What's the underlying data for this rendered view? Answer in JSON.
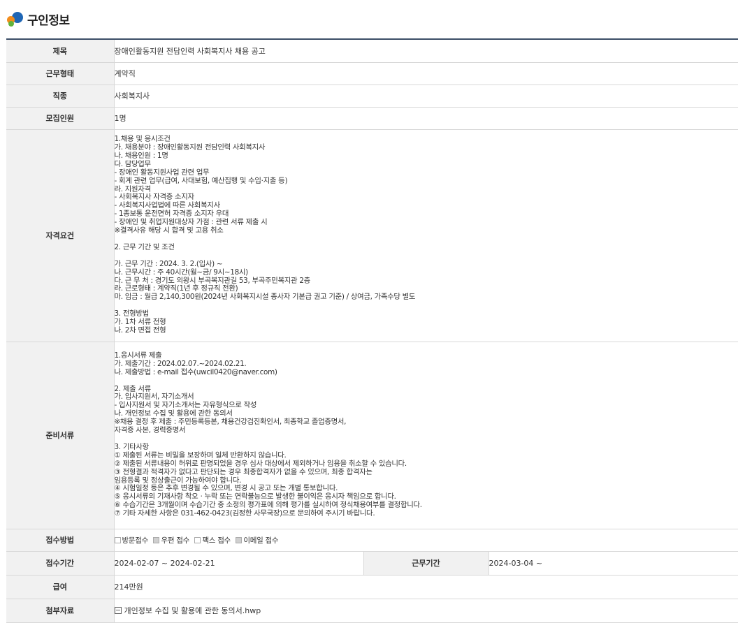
{
  "header": {
    "title": "구인정보"
  },
  "colors": {
    "top_line": "#3c4e67",
    "label_bg": "#f1f1f1",
    "border": "#d8d8d8",
    "logo": [
      "#1f66b5",
      "#f28c1c",
      "#62b33a"
    ]
  },
  "rows": {
    "title": {
      "label": "제목",
      "value": "장애인활동지원 전담인력 사회복지사 채용 공고"
    },
    "work_type": {
      "label": "근무형태",
      "value": "계약직"
    },
    "job_type": {
      "label": "직종",
      "value": "사회복지사"
    },
    "headcount": {
      "label": "모집인원",
      "value": "1명"
    },
    "qualifications": {
      "label": "자격요건",
      "value": "1.채용 및 응시조건\n가. 채용분야 : 장애인활동지원 전담인력 사회복지사\n나. 채용인원 : 1명\n다. 담당업무\n- 장애인 활동지원사업 관련 업무\n- 회계 관련 업무(급여, 사대보험, 예산집행 및 수입·지출 등)\n라. 지원자격\n- 사회복지사 자격증 소지자\n- 사회복지사업법에 따른 사회복지사\n- 1종보통 운전면허 자격증 소지자 우대\n- 장애인 및 취업지원대상자 가점 : 관련 서류 제출 시\n※결격사유 해당 시 합격 및 고용 취소\n\n2. 근무 기간 및 조건\n\n가. 근무 기간 : 2024. 3. 2.(입사) ~\n나. 근무시간 : 주 40시간(월~금/ 9시~18시)\n다. 근 무 처 : 경기도 의왕시 부곡복지관길 53, 부곡주민복지관 2층\n라. 근로형태 : 계약직(1년 후 정규직 전환)\n마. 임금 : 월급 2,140,300원(2024년 사회복지시설 종사자 기본급 권고 기준) / 상여금, 가족수당 별도\n\n3. 전형방법\n가. 1차 서류 전형\n나. 2차 면접 전형"
    },
    "documents": {
      "label": "준비서류",
      "value": "1.응시서류 제출\n가. 제출기간 : 2024.02.07.~2024.02.21.\n나. 제출방법 : e-mail 접수(uwcil0420@naver.com)\n\n2. 제출 서류\n가. 입사지원서, 자기소개서\n- 입사지원서 및 자기소개서는 자유형식으로 작성\n나. 개인정보 수집 및 활용에 관한 동의서\n※채용 결정 후 제출 : 주민등록등본, 채용건강검진확인서, 최종학교 졸업증명서,\n자격증 사본, 경력증명서\n\n3. 기타사항\n① 제출된 서류는 비밀을 보장하며 일체 반환하지 않습니다.\n② 제출된 서류내용이 허위로 판명되었을 경우 심사 대상에서 제외하거나 임용을 취소할 수 있습니다.\n③ 전형결과 적격자가 없다고 판단되는 경우 최종합격자가 없을 수 있으며, 최종 합격자는\n임용등록 및 정상출근이 가능하여야 합니다.\n④ 시험일정 등은 추후 변경될 수 있으며, 변경 시 공고 또는 개별 통보합니다.\n⑤ 응시서류의 기재사항 착오ㆍ누락 또는 연락불능으로 발생한 불이익은 응시자 책임으로 합니다.\n⑥ 수습기간은 3개월이며 수습기간 중 소정의 평가표에 의해 평가를 실시하여 정식채용여부를 결정합니다.\n⑦ 기타 자세한 사항은 031-462-0423(김정한 사무국장)으로 문의하여 주시기 바랍니다."
    },
    "apply_method": {
      "label": "접수방법",
      "options": [
        {
          "label": "방문접수",
          "checked": false
        },
        {
          "label": "우편 접수",
          "checked": true
        },
        {
          "label": "팩스 접수",
          "checked": false
        },
        {
          "label": "이메일 접수",
          "checked": true
        }
      ]
    },
    "apply_period": {
      "label": "접수기간",
      "value": "2024-02-07 ~ 2024-02-21",
      "work_period_label": "근무기간",
      "work_period_value": "2024-03-04 ~"
    },
    "salary": {
      "label": "급여",
      "value": "214만원"
    },
    "attachment": {
      "label": "첨부자료",
      "file": "개인정보 수집 및 활용에 관한 동의서.hwp"
    }
  }
}
